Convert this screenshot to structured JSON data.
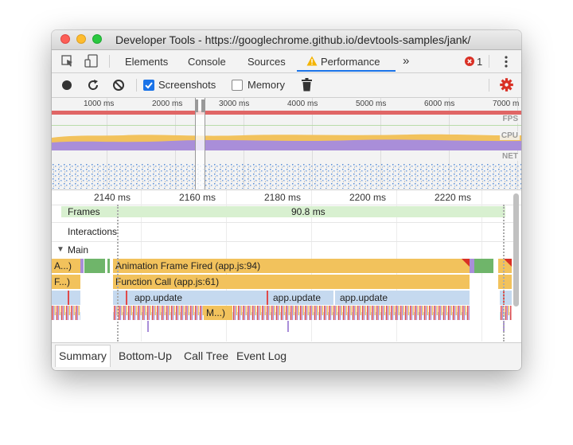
{
  "window": {
    "title": "Developer Tools - https://googlechrome.github.io/devtools-samples/jank/"
  },
  "tabs": {
    "inspect_icon": "cursor-select-icon",
    "device_icon": "device-toggle-icon",
    "items": [
      {
        "label": "Elements"
      },
      {
        "label": "Console"
      },
      {
        "label": "Sources"
      },
      {
        "label": "Performance",
        "active": true,
        "warning_icon": "warning-triangle-icon"
      }
    ],
    "more_label": "»",
    "error_count": "1",
    "error_color": "#d93025",
    "menu_icon": "kebab-menu-icon"
  },
  "toolbar": {
    "record_icon": "record-icon",
    "reload_icon": "reload-icon",
    "clear_icon": "clear-icon",
    "screenshots_label": "Screenshots",
    "screenshots_checked": true,
    "memory_label": "Memory",
    "memory_checked": false,
    "trash_icon": "trash-icon",
    "settings_icon": "gear-icon",
    "settings_color": "#d93025"
  },
  "overview": {
    "ticks": [
      "1000 ms",
      "2000 ms",
      "3000 ms",
      "4000 ms",
      "5000 ms",
      "6000 ms",
      "7000 m"
    ],
    "fps_label": "FPS",
    "cpu_label": "CPU",
    "net_label": "NET"
  },
  "flamechart": {
    "ruler_ticks": [
      "2140 ms",
      "2160 ms",
      "2180 ms",
      "2200 ms",
      "2220 ms"
    ],
    "frames_label": "Frames",
    "frame_duration": "90.8 ms",
    "interactions_label": "Interactions",
    "main_label": "Main",
    "main_arrow": "▼",
    "row1": {
      "left": "A...)",
      "main": "Animation Frame Fired (app.js:94)"
    },
    "row2": {
      "left": "F...)",
      "main": "Function Call (app.js:61)"
    },
    "row3": {
      "items": [
        "app.update",
        "app.update",
        "app.update"
      ]
    },
    "row4": {
      "small": "M...)"
    },
    "colors": {
      "scripting": "#f2c25c",
      "app_update": "#c5d9ef",
      "frame": "#d8f0d0",
      "idle": "#6fb56a"
    }
  },
  "bottom_tabs": {
    "items": [
      {
        "label": "Summary",
        "active": true
      },
      {
        "label": "Bottom-Up"
      },
      {
        "label": "Call Tree"
      },
      {
        "label": "Event Log"
      }
    ]
  }
}
